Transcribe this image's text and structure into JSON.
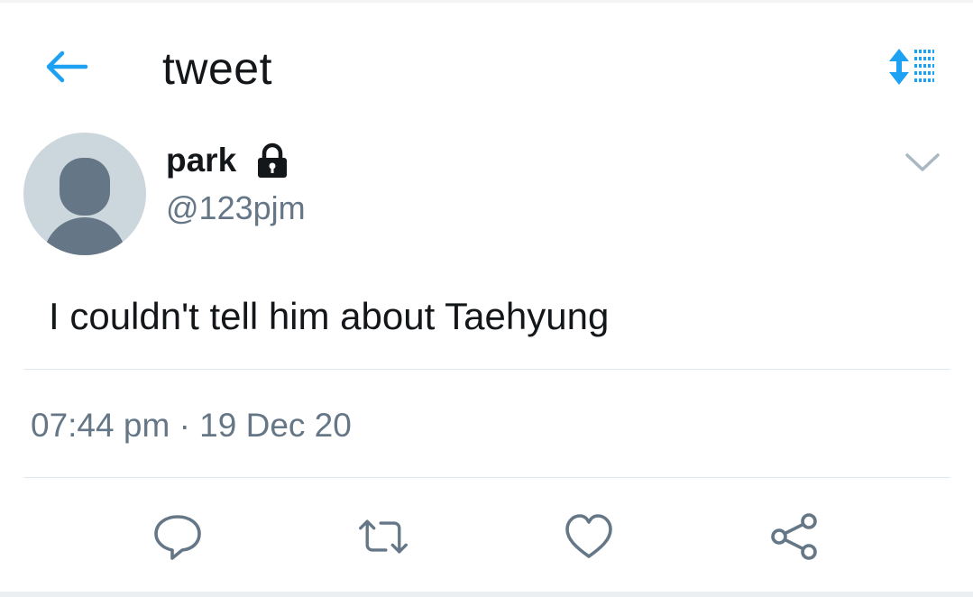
{
  "header": {
    "title": "tweet",
    "back_icon": "arrow-left-icon",
    "sort_icon": "sort-list-icon"
  },
  "author": {
    "display_name": "park",
    "handle": "@123pjm",
    "protected_icon": "lock-icon",
    "menu_icon": "chevron-down-icon"
  },
  "tweet": {
    "text": "I couldn't tell him about Taehyung",
    "time": "07:44 pm",
    "separator": "·",
    "date": "19 Dec 20"
  },
  "actions": [
    {
      "icon": "reply-icon"
    },
    {
      "icon": "retweet-icon"
    },
    {
      "icon": "like-icon"
    },
    {
      "icon": "share-icon"
    }
  ],
  "colors": {
    "accent": "#1da1f2",
    "text_primary": "#14171a",
    "text_secondary": "#657786",
    "divider": "#e1e8ed",
    "avatar_bg": "#ccd6dd",
    "avatar_fg": "#657786"
  }
}
